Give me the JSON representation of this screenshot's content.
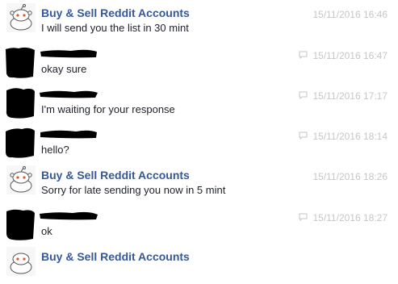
{
  "messages": [
    {
      "sender": "Buy & Sell Reddit Accounts",
      "text": "I will send you the list in 30 mint",
      "time": "15/11/2016 16:46"
    },
    {
      "sender": "",
      "text": "okay sure",
      "time": "15/11/2016 16:47"
    },
    {
      "sender": "",
      "text": "I'm waiting for your response",
      "time": "15/11/2016 17:17"
    },
    {
      "sender": "",
      "text": "hello?",
      "time": "15/11/2016 18:14"
    },
    {
      "sender": "Buy & Sell Reddit Accounts",
      "text": "Sorry for late sending you now in 5 mint",
      "time": "15/11/2016 18:26"
    },
    {
      "sender": "",
      "text": "ok",
      "time": "15/11/2016 18:27"
    },
    {
      "sender": "Buy & Sell Reddit Accounts",
      "text": "",
      "time": ""
    }
  ],
  "icons": {
    "page_avatar": "reddit-alien-icon",
    "reply": "speech-bubble-icon"
  },
  "colors": {
    "sender_name": "#365899",
    "message_text": "#1d2129",
    "timestamp": "#c4c6ca",
    "redaction": "#000000"
  }
}
